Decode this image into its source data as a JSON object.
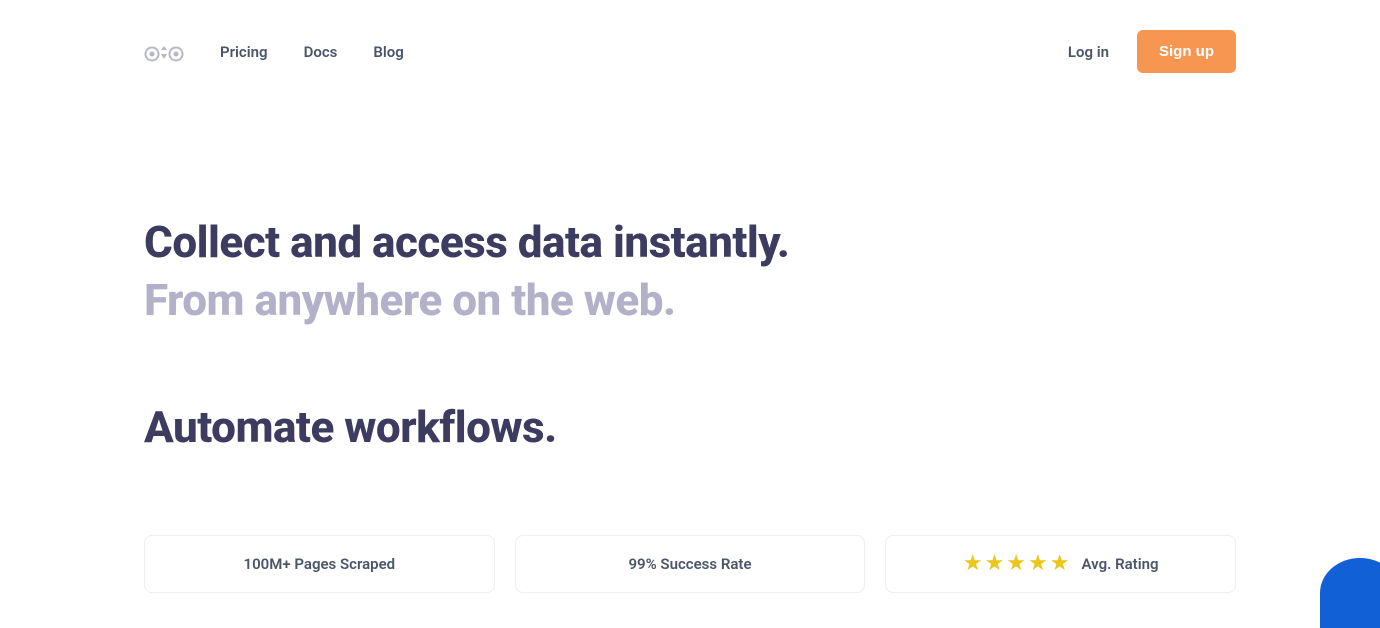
{
  "nav": {
    "pricing": "Pricing",
    "docs": "Docs",
    "blog": "Blog",
    "login": "Log in",
    "signup": "Sign up"
  },
  "hero": {
    "title_line1": "Collect and access data instantly.",
    "title_line2": "From anywhere on the web.",
    "subtitle": "Automate workflows."
  },
  "stats": {
    "pages_scraped": "100M+ Pages Scraped",
    "success_rate": "99% Success Rate",
    "rating_label": "Avg. Rating",
    "rating_stars": 5
  }
}
